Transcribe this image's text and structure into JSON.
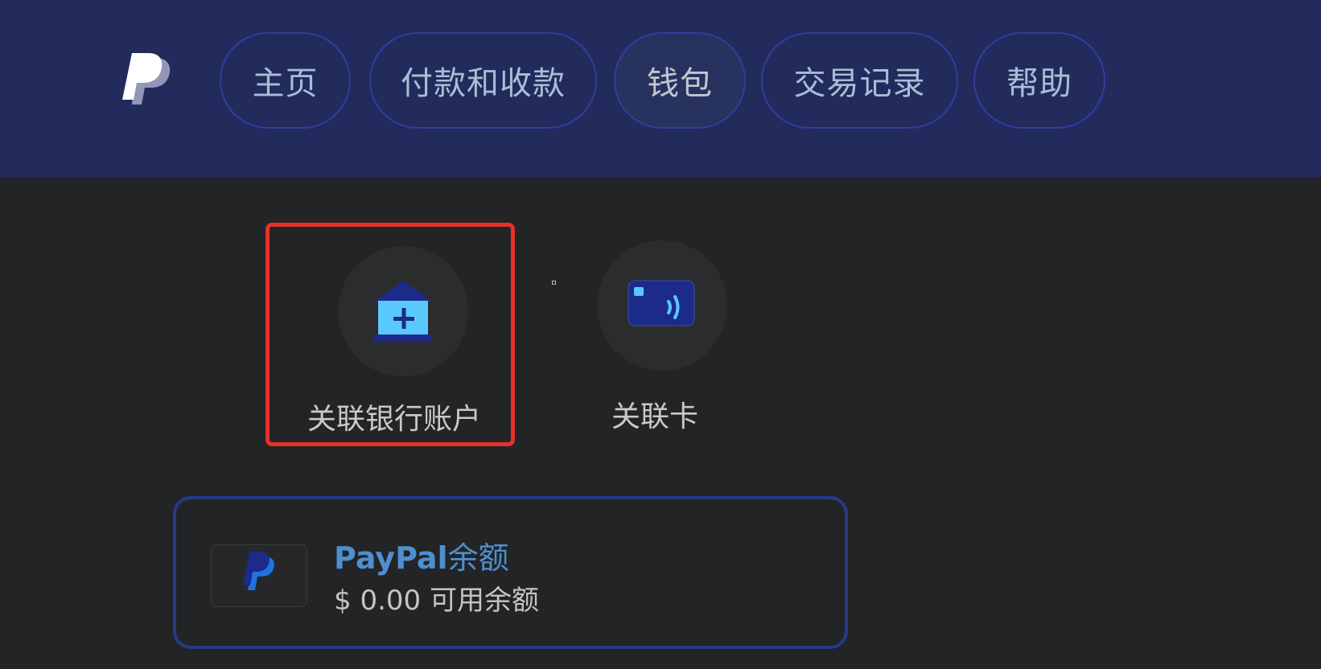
{
  "colors": {
    "header_bg": "#222b5c",
    "page_bg": "#232426",
    "pill_border": "#2f3f9e",
    "nav_text": "#a7bed6",
    "selection_outline": "#e8312b",
    "card_border": "#263a8a",
    "link_blue": "#4e8fcf"
  },
  "header": {
    "logo_icon": "paypal-logo",
    "nav": [
      {
        "label": "主页"
      },
      {
        "label": "付款和收款"
      },
      {
        "label": "钱包",
        "active": true
      },
      {
        "label": "交易记录"
      },
      {
        "label": "帮助"
      }
    ]
  },
  "wallet": {
    "actions": [
      {
        "label": "关联银行账户",
        "icon": "bank-add-icon",
        "selected": true
      },
      {
        "label": "关联卡",
        "icon": "card-contactless-icon"
      }
    ],
    "balance": {
      "brand": "PayPal",
      "title_suffix": "余额",
      "amount": "$ 0.00 可用余额",
      "icon": "paypal-icon"
    }
  }
}
